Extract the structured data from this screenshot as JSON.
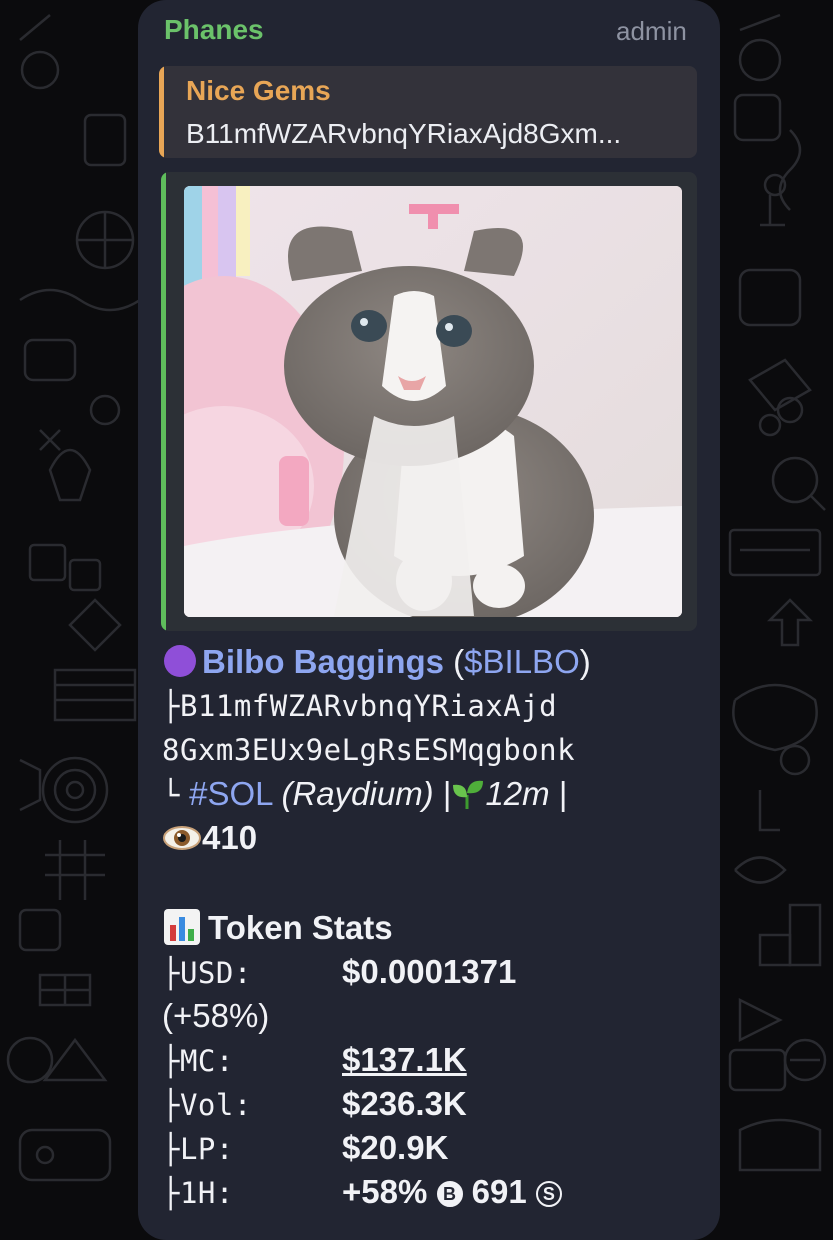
{
  "message": {
    "sender": "Phanes",
    "role": "admin",
    "reply": {
      "title": "Nice Gems",
      "text": "B11mfWZARvbnqYRiaxAjd8Gxm..."
    },
    "link_preview": {
      "image": "photo of a grey and white kitten"
    },
    "token": {
      "name": "Bilbo Baggings",
      "ticker_open": "(",
      "ticker": "$BILBO",
      "ticker_close": ")",
      "address_prefix": "├",
      "address_line1": "B11mfWZARvbnqYRiaxAjd",
      "address_line2": "8Gxm3EUx9eLgRsESMqgbonk",
      "chain_prefix": "└",
      "chain": "#SOL",
      "dex": "(Raydium)",
      "separator": "|",
      "age": "12m",
      "separator2": "|",
      "views": "410"
    },
    "stats": {
      "heading": "Token Stats",
      "usd_label": "├USD:",
      "usd_value": "$0.0001371",
      "usd_change": "(+58%)",
      "mc_label": "├MC:",
      "mc_value": "$137.1K",
      "vol_label": "├Vol:",
      "vol_value": "$236.3K",
      "lp_label": "├LP:",
      "lp_value": "$20.9K",
      "h1_label": "├1H:",
      "h1_change": "+58%",
      "h1_buy_badge": "B",
      "h1_buys": "691",
      "h1_sell_badge": "S"
    }
  },
  "colors": {
    "background": "#0b0b0d",
    "bubble": "#222532",
    "sender": "#6bc26a",
    "reply_accent": "#e8a656",
    "preview_accent": "#5fbd5c",
    "link": "#8ea6f0",
    "text": "#f1f2f6"
  },
  "icons": [
    "purple-circle-icon",
    "seedling-icon",
    "eye-icon",
    "bar-chart-icon"
  ]
}
